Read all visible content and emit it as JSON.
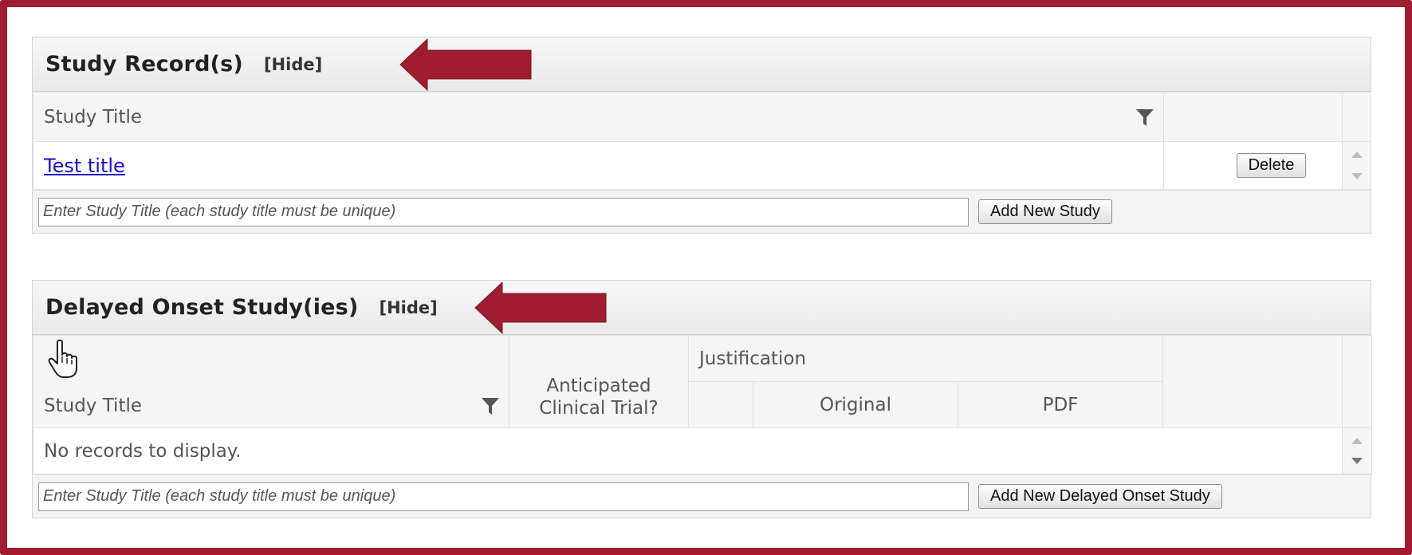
{
  "study_records": {
    "title": "Study Record(s)",
    "hide_label": "[Hide]",
    "columns": {
      "study_title": "Study Title"
    },
    "rows": [
      {
        "title": "Test title",
        "delete_label": "Delete"
      }
    ],
    "add_input_placeholder": "Enter Study Title (each study title must be unique)",
    "add_button_label": "Add New Study"
  },
  "delayed_onset": {
    "title": "Delayed Onset Study(ies)",
    "hide_label": "[Hide]",
    "columns": {
      "study_title": "Study Title",
      "anticipated": "Anticipated Clinical Trial?",
      "justification": "Justification",
      "original": "Original",
      "pdf": "PDF"
    },
    "empty_message": "No records to display.",
    "add_input_placeholder": "Enter Study Title (each study title must be unique)",
    "add_button_label": "Add New Delayed Onset Study"
  },
  "colors": {
    "frame": "#a01c30",
    "arrow": "#a01c30",
    "link": "#1a0dcc"
  },
  "icons": [
    "filter-icon",
    "arrow-left-icon",
    "hand-cursor-icon",
    "scroll-up-icon",
    "scroll-down-icon"
  ]
}
